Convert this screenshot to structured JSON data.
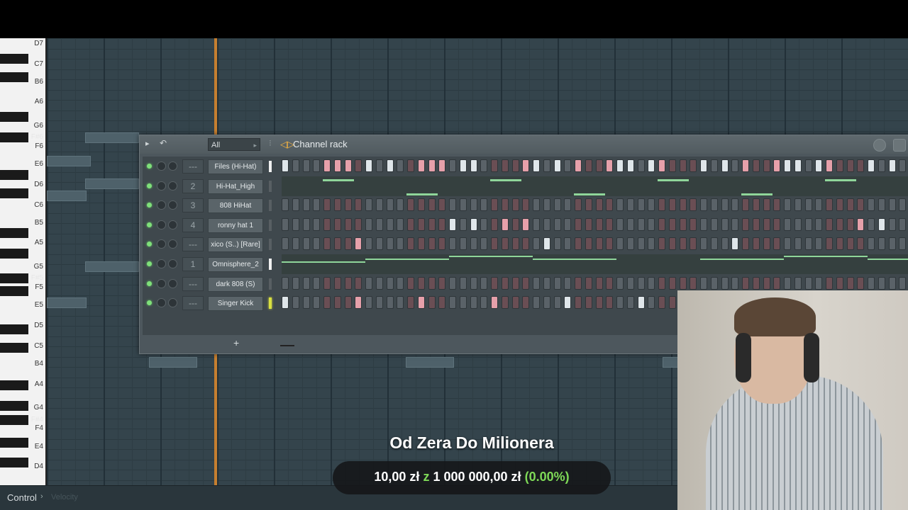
{
  "piano_roll": {
    "key_labels": [
      {
        "label": "D7",
        "black": false
      },
      {
        "label": "C7",
        "black": false
      },
      {
        "label": "B6",
        "black": false
      },
      {
        "label": "A6",
        "black": false
      },
      {
        "label": "G6",
        "black": false
      },
      {
        "label": "F#6",
        "black": true
      },
      {
        "label": "F6",
        "black": false
      },
      {
        "label": "E6",
        "black": false
      },
      {
        "label": "D6",
        "black": false
      },
      {
        "label": "C6",
        "black": false
      },
      {
        "label": "B5",
        "black": false
      },
      {
        "label": "A5",
        "black": false
      },
      {
        "label": "G5",
        "black": false
      },
      {
        "label": "F#5",
        "black": true
      },
      {
        "label": "F5",
        "black": false
      },
      {
        "label": "E5",
        "black": false
      },
      {
        "label": "D5",
        "black": false
      },
      {
        "label": "C5",
        "black": false
      },
      {
        "label": "B4",
        "black": false
      },
      {
        "label": "A4",
        "black": false
      },
      {
        "label": "G4",
        "black": false
      },
      {
        "label": "F#4",
        "black": true
      },
      {
        "label": "F4",
        "black": false
      },
      {
        "label": "E4",
        "black": false
      },
      {
        "label": "D4",
        "black": false
      }
    ],
    "control_label": "Control",
    "control_sub": "Velocity"
  },
  "channel_rack": {
    "title": "Channel rack",
    "filter": "All",
    "add_label": "+",
    "channels": [
      {
        "mixer": "---",
        "name": "Files (Hi-Hat)",
        "selected": "on",
        "type": "steps",
        "pattern": "1000111010100111011000011010100111011000101010011101100010101001110110001"
      },
      {
        "mixer": "2",
        "name": "Hi-Hat_High",
        "selected": "off",
        "type": "piano"
      },
      {
        "mixer": "3",
        "name": "808 HiHat",
        "selected": "off",
        "type": "steps",
        "pattern": "0"
      },
      {
        "mixer": "4",
        "name": "ronny hat 1",
        "selected": "off",
        "type": "steps",
        "pattern": "0000000000000000101001010000000000000000000000000000000101001010"
      },
      {
        "mixer": "---",
        "name": "xico (S..) [Rare]",
        "selected": "off",
        "type": "steps",
        "pattern": "0000000100000000000000000100000000000000000100000000000000000110011"
      },
      {
        "mixer": "1",
        "name": "Omnisphere_2",
        "selected": "on",
        "type": "lines"
      },
      {
        "mixer": "---",
        "name": "dark 808 (S)",
        "selected": "off",
        "type": "steps",
        "pattern": "0"
      },
      {
        "mixer": "---",
        "name": "Singer Kick",
        "selected": "yellow",
        "type": "steps",
        "pattern": "1000000100000100000010000001000000100000010000001"
      }
    ]
  },
  "overlay": {
    "title": "Od Zera Do Milionera",
    "amount": "10,00 zł",
    "sep": "z",
    "goal": "1 000 000,00 zł",
    "percent": "(0.00%)"
  }
}
